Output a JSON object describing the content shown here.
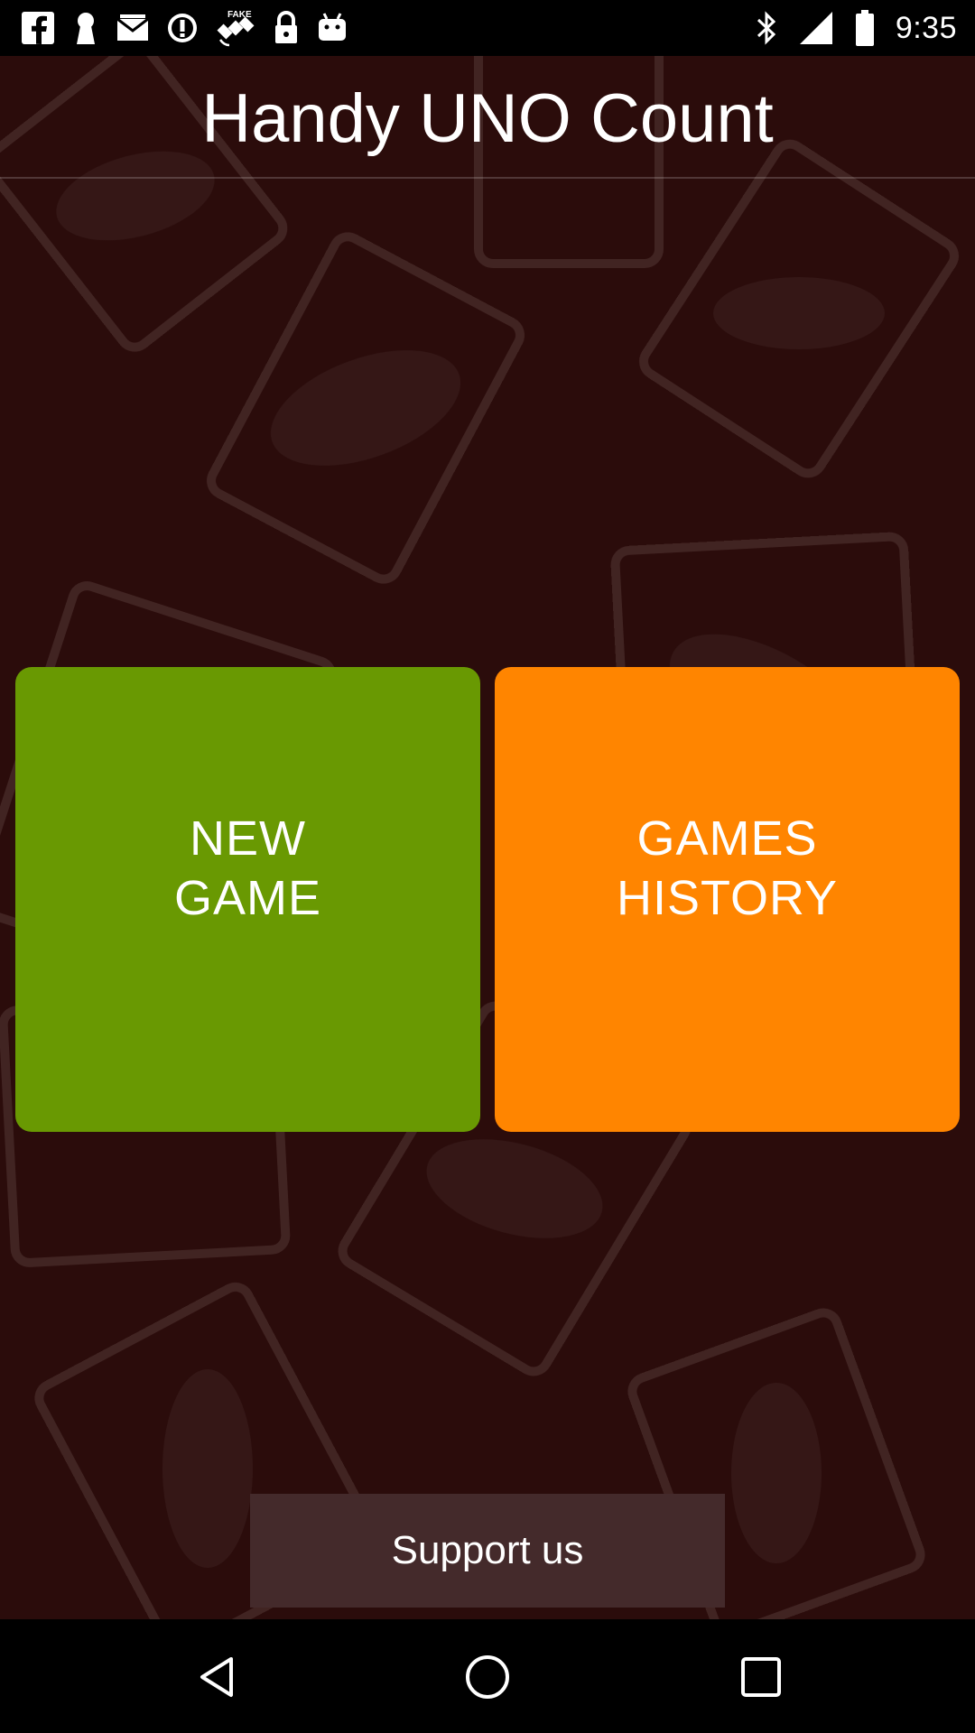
{
  "status_bar": {
    "time": "9:35",
    "left_icons": [
      "facebook-icon",
      "keyhole-icon",
      "mail-icon",
      "info-circle-icon",
      "fake-gps-satellite-icon",
      "lock-icon",
      "android-icon"
    ],
    "right_icons": [
      "bluetooth-icon",
      "signal-icon",
      "battery-icon"
    ]
  },
  "app": {
    "title": "Handy UNO Count",
    "background_color": "#2b0c0b",
    "new_game": {
      "line1": "NEW",
      "line2": "GAME",
      "color": "#699902"
    },
    "games_history": {
      "line1": "GAMES",
      "line2": "HISTORY",
      "color": "#ff8500"
    },
    "support_label": "Support us"
  },
  "nav_bar": {
    "icons": [
      "back-triangle-icon",
      "home-circle-icon",
      "recent-square-icon"
    ]
  }
}
